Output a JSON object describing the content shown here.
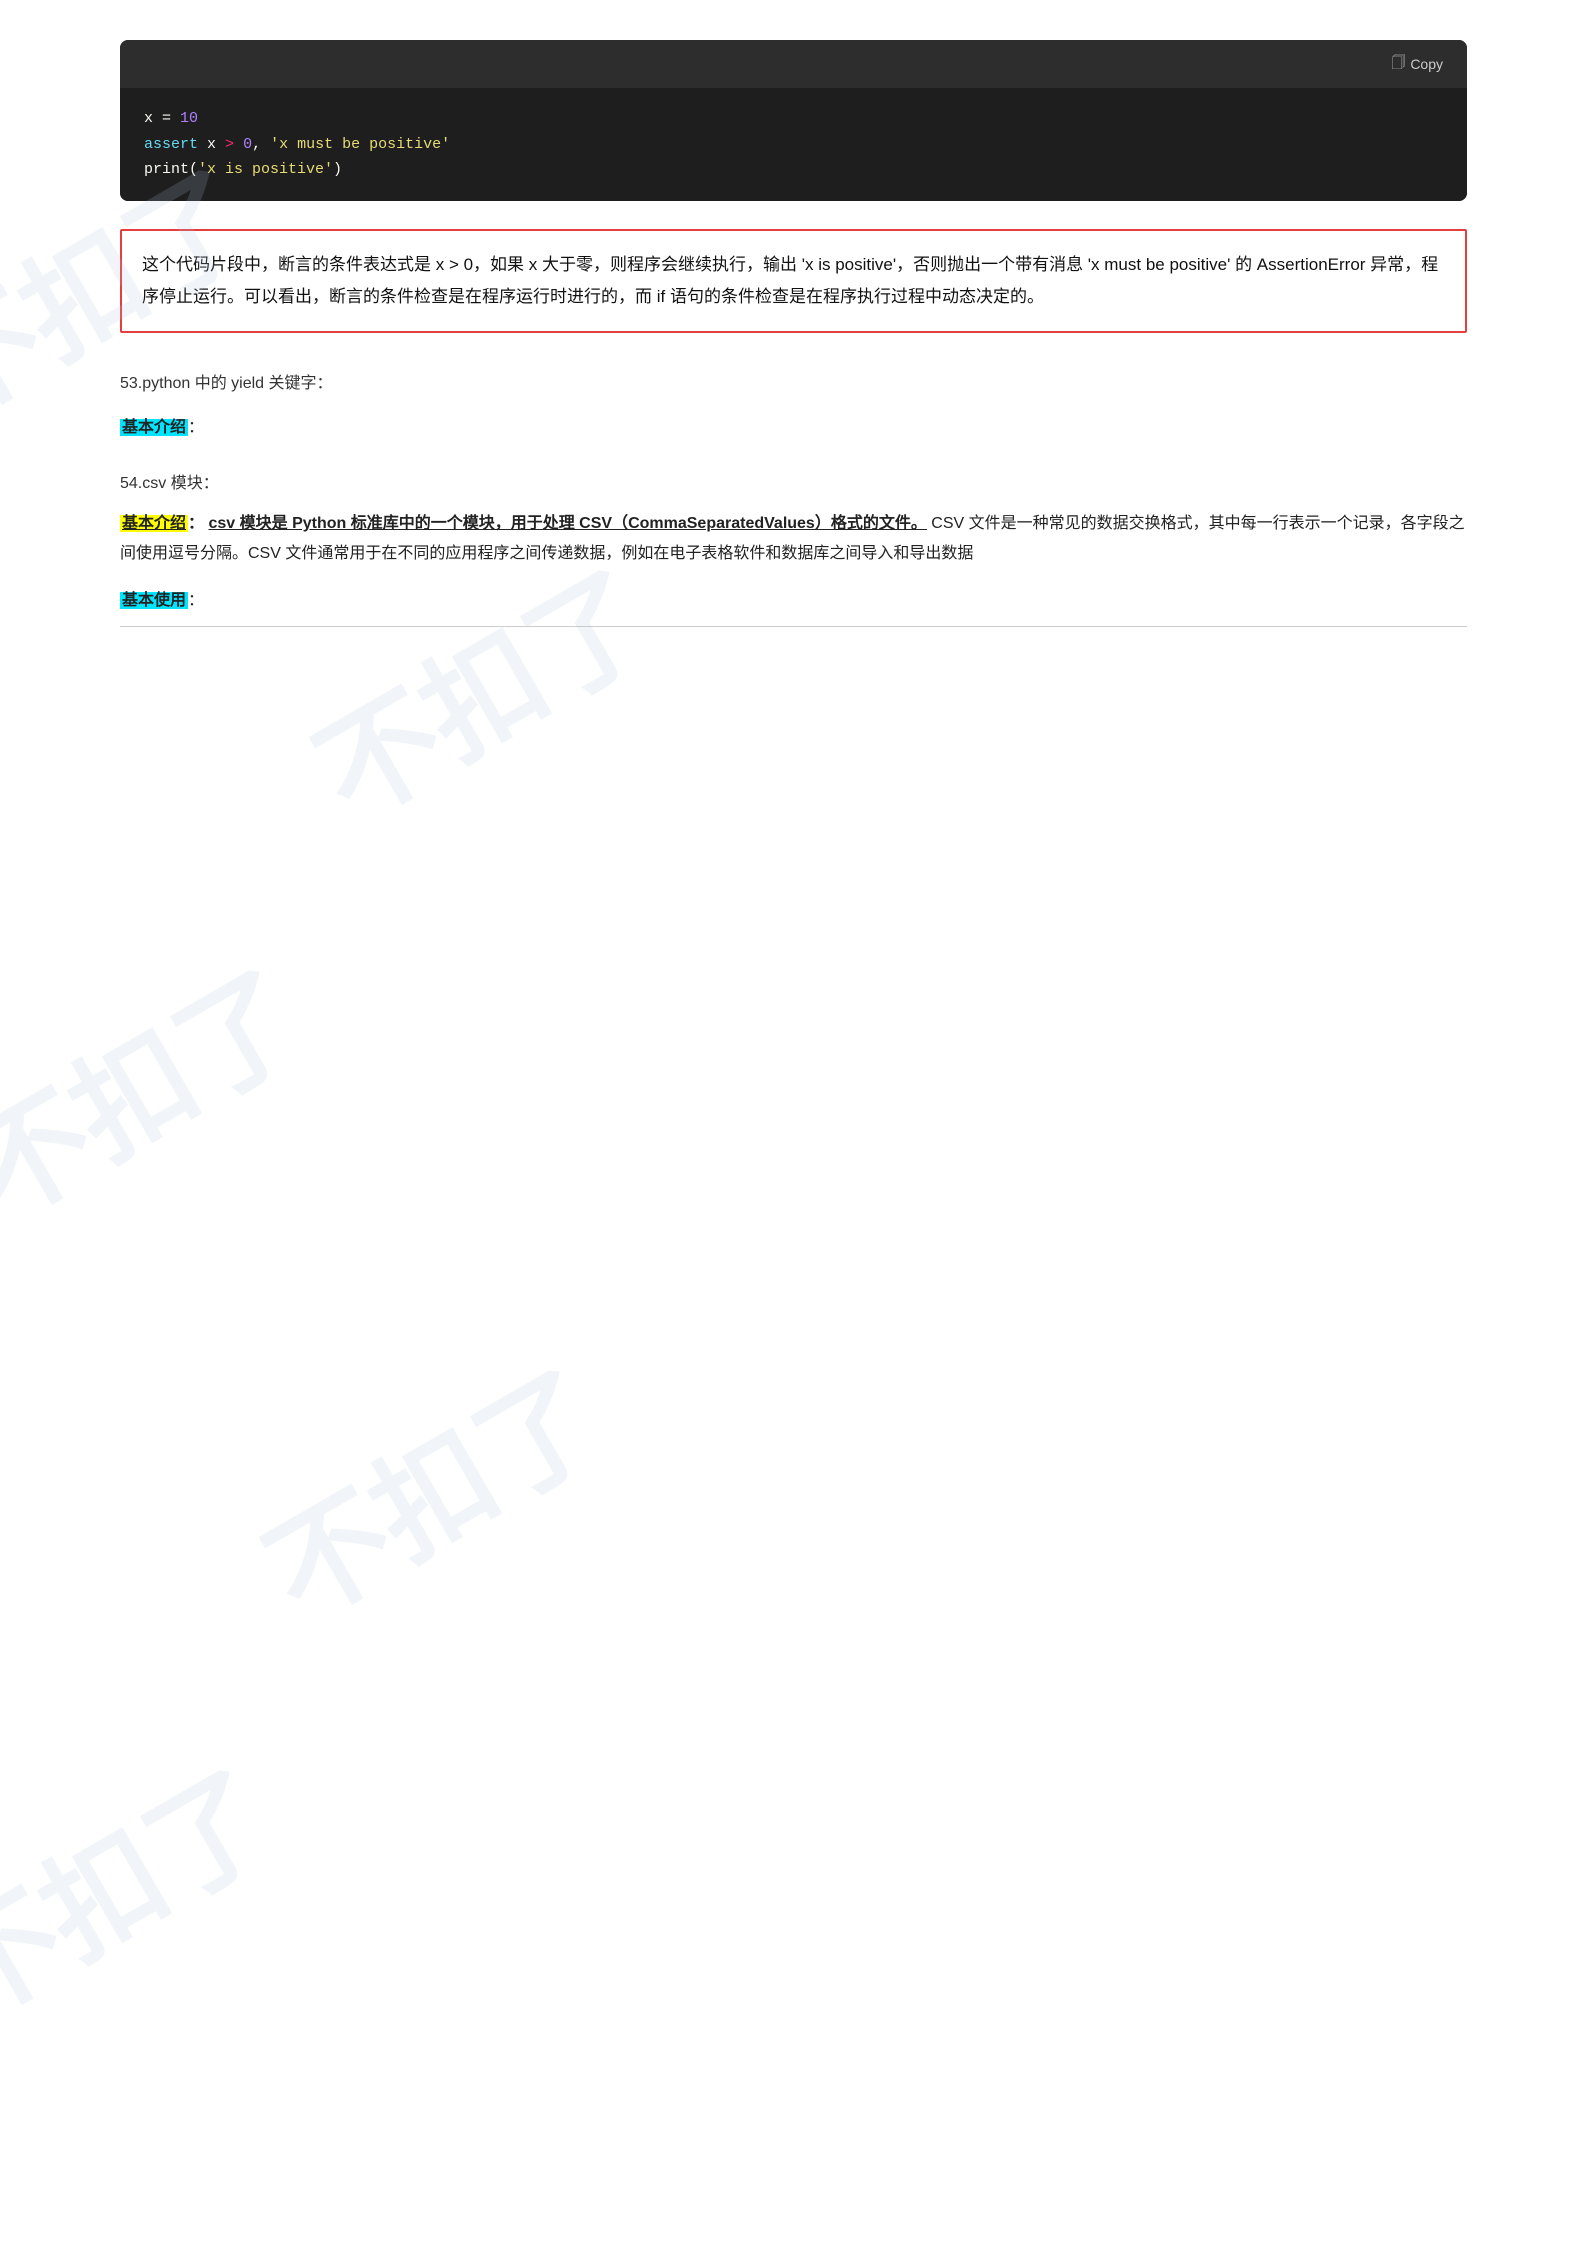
{
  "code_block": {
    "copy_label": "Copy",
    "lines": [
      {
        "id": "line1",
        "text": "x = 10"
      },
      {
        "id": "line2",
        "parts": [
          {
            "text": "assert",
            "class": "code-keyword"
          },
          {
            "text": " x "
          },
          {
            "text": ">",
            "class": "code-operator"
          },
          {
            "text": " "
          },
          {
            "text": "0",
            "class": "code-number"
          },
          {
            "text": ", "
          },
          {
            "text": "'x must be positive'",
            "class": "code-string"
          }
        ]
      },
      {
        "id": "line3",
        "parts": [
          {
            "text": "print"
          },
          {
            "text": "("
          },
          {
            "text": "'x is positive'",
            "class": "code-string"
          },
          {
            "text": ")"
          }
        ]
      }
    ]
  },
  "explanation": {
    "text": "这个代码片段中，断言的条件表达式是 x > 0，如果 x 大于零，则程序会继续执行，输出 'x is positive'，否则抛出一个带有消息 'x must be positive' 的 AssertionError 异常，程序停止运行。可以看出，断言的条件检查是在程序运行时进行的，而 if 语句的条件检查是在程序执行过程中动态决定的。"
  },
  "section53": {
    "title": "53.python 中的 yield 关键字：",
    "intro_label": "基本介绍："
  },
  "section54": {
    "title": "54.csv 模块：",
    "intro_label": "基本介绍：",
    "intro_bold_parts": "csv 模块是 Python 标准库中的一个模块，用于处理 CSV（CommaSeparatedValues）格式的文件。",
    "intro_rest": "CSV 文件是一种常见的数据交换格式，其中每一行表示一个记录，各字段之间使用逗号分隔。CSV 文件通常用于在不同的应用程序之间传递数据，例如在电子表格软件和数据库之间导入和导出数据",
    "usage_label": "基本使用："
  },
  "watermark": {
    "texts": [
      "不扣了",
      "不扣了",
      "不扣了"
    ]
  }
}
